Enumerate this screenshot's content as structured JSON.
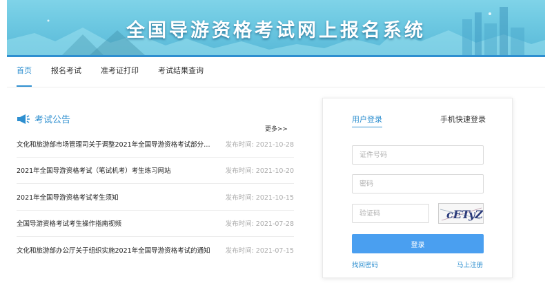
{
  "banner": {
    "title": "全国导游资格考试网上报名系统"
  },
  "nav": [
    {
      "label": "首页"
    },
    {
      "label": "报名考试"
    },
    {
      "label": "准考证打印"
    },
    {
      "label": "考试结果查询"
    }
  ],
  "notices": {
    "title": "考试公告",
    "more": "更多>>",
    "items": [
      {
        "title": "文化和旅游部市场管理司关于调整2021年全国导游资格考试部分…",
        "date": "发布时间: 2021-10-28"
      },
      {
        "title": "2021年全国导游资格考试（笔试机考）考生练习网站",
        "date": "发布时间: 2021-10-20"
      },
      {
        "title": "2021年全国导游资格考试考生须知",
        "date": "发布时间: 2021-10-15"
      },
      {
        "title": "全国导游资格考试考生操作指南视频",
        "date": "发布时间: 2021-07-28"
      },
      {
        "title": "文化和旅游部办公厅关于组织实施2021年全国导游资格考试的通知",
        "date": "发布时间: 2021-07-15"
      }
    ]
  },
  "login": {
    "tab_user": "用户登录",
    "tab_phone": "手机快速登录",
    "id_placeholder": "证件号码",
    "pwd_placeholder": "密码",
    "code_placeholder": "验证码",
    "captcha_text": "cETyZ",
    "submit": "登录",
    "forgot": "找回密码",
    "register": "马上注册"
  },
  "colors": {
    "accent": "#2e8fd0",
    "button": "#4a9ff0",
    "banner": "#6ec9e2"
  },
  "icons": {
    "notice": "megaphone-icon"
  }
}
